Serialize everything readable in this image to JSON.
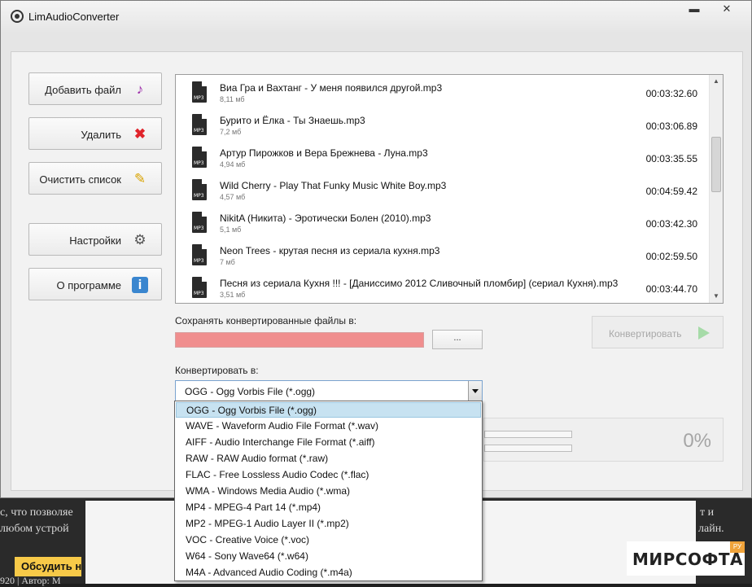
{
  "window": {
    "title": "LimAudioConverter",
    "minimize_glyph": "▬",
    "close_glyph": "✕"
  },
  "sidebar": {
    "buttons": [
      {
        "label": "Добавить файл",
        "icon": "add-music-icon",
        "glyph": "♪"
      },
      {
        "label": "Удалить",
        "icon": "delete-icon",
        "glyph": "✖"
      },
      {
        "label": "Очистить список",
        "icon": "broom-icon",
        "glyph": "✎"
      },
      {
        "label": "Настройки",
        "icon": "gear-icon",
        "glyph": "⚙"
      },
      {
        "label": "О программе",
        "icon": "info-icon",
        "glyph": "i"
      }
    ]
  },
  "file_list": {
    "file_icon_text": "MP3",
    "items": [
      {
        "name": "Виа Гра и Вахтанг - У меня появился другой.mp3",
        "size": "8,11 мб",
        "duration": "00:03:32.60"
      },
      {
        "name": "Бурито и Ёлка - Ты Знаешь.mp3",
        "size": "7,2 мб",
        "duration": "00:03:06.89"
      },
      {
        "name": "Артур Пирожков и Вера Брежнева  - Луна.mp3",
        "size": "4,94 мб",
        "duration": "00:03:35.55"
      },
      {
        "name": "Wild Cherry - Play That Funky Music White Boy.mp3",
        "size": "4,57 мб",
        "duration": "00:04:59.42"
      },
      {
        "name": "NikitA (Никита) - Эротически Болен (2010).mp3",
        "size": "5,1 мб",
        "duration": "00:03:42.30"
      },
      {
        "name": "Neon Trees - крутая песня из сериала кухня.mp3",
        "size": "7 мб",
        "duration": "00:02:59.50"
      },
      {
        "name": "Песня из сериала  Кухня !!! -  [Даниссимо 2012 Сливочный пломбир] (сериал Кухня).mp3",
        "size": "3,51 мб",
        "duration": "00:03:44.70"
      }
    ]
  },
  "save": {
    "label": "Сохранять конвертированные файлы в:",
    "path": "",
    "browse_label": "..."
  },
  "convert": {
    "label": "Конвертировать",
    "accent": "#a6dba8"
  },
  "format": {
    "label": "Конвертировать в:",
    "selected": "OGG - Ogg Vorbis File (*.ogg)",
    "options": [
      "OGG - Ogg Vorbis File (*.ogg)",
      "WAVE - Waveform Audio File Format (*.wav)",
      "AIFF - Audio Interchange File Format (*.aiff)",
      "RAW - RAW Audio format (*.raw)",
      "FLAC - Free Lossless Audio Codec (*.flac)",
      "WMA - Windows Media Audio (*.wma)",
      "MP4 - MPEG-4 Part 14 (*.mp4)",
      "MP2 - MPEG-1 Audio Layer II (*.mp2)",
      "VOC - Creative Voice (*.voc)",
      "W64 - Sony Wave64 (*.w64)",
      "M4A - Advanced Audio Coding (*.m4a)"
    ]
  },
  "progress": {
    "percent_text": "0%",
    "file_progress": 0,
    "total_progress": 0
  },
  "background_page": {
    "line1": "с, что позволяе",
    "line2": "любом устрой",
    "line3": "920 | Автор: М",
    "right1": "т и",
    "right2": "лайн.",
    "button": "Обсудить н"
  },
  "watermark": {
    "text": "МИРСОФТА",
    "badge": "РУ",
    "accent": "#f0a33a"
  }
}
